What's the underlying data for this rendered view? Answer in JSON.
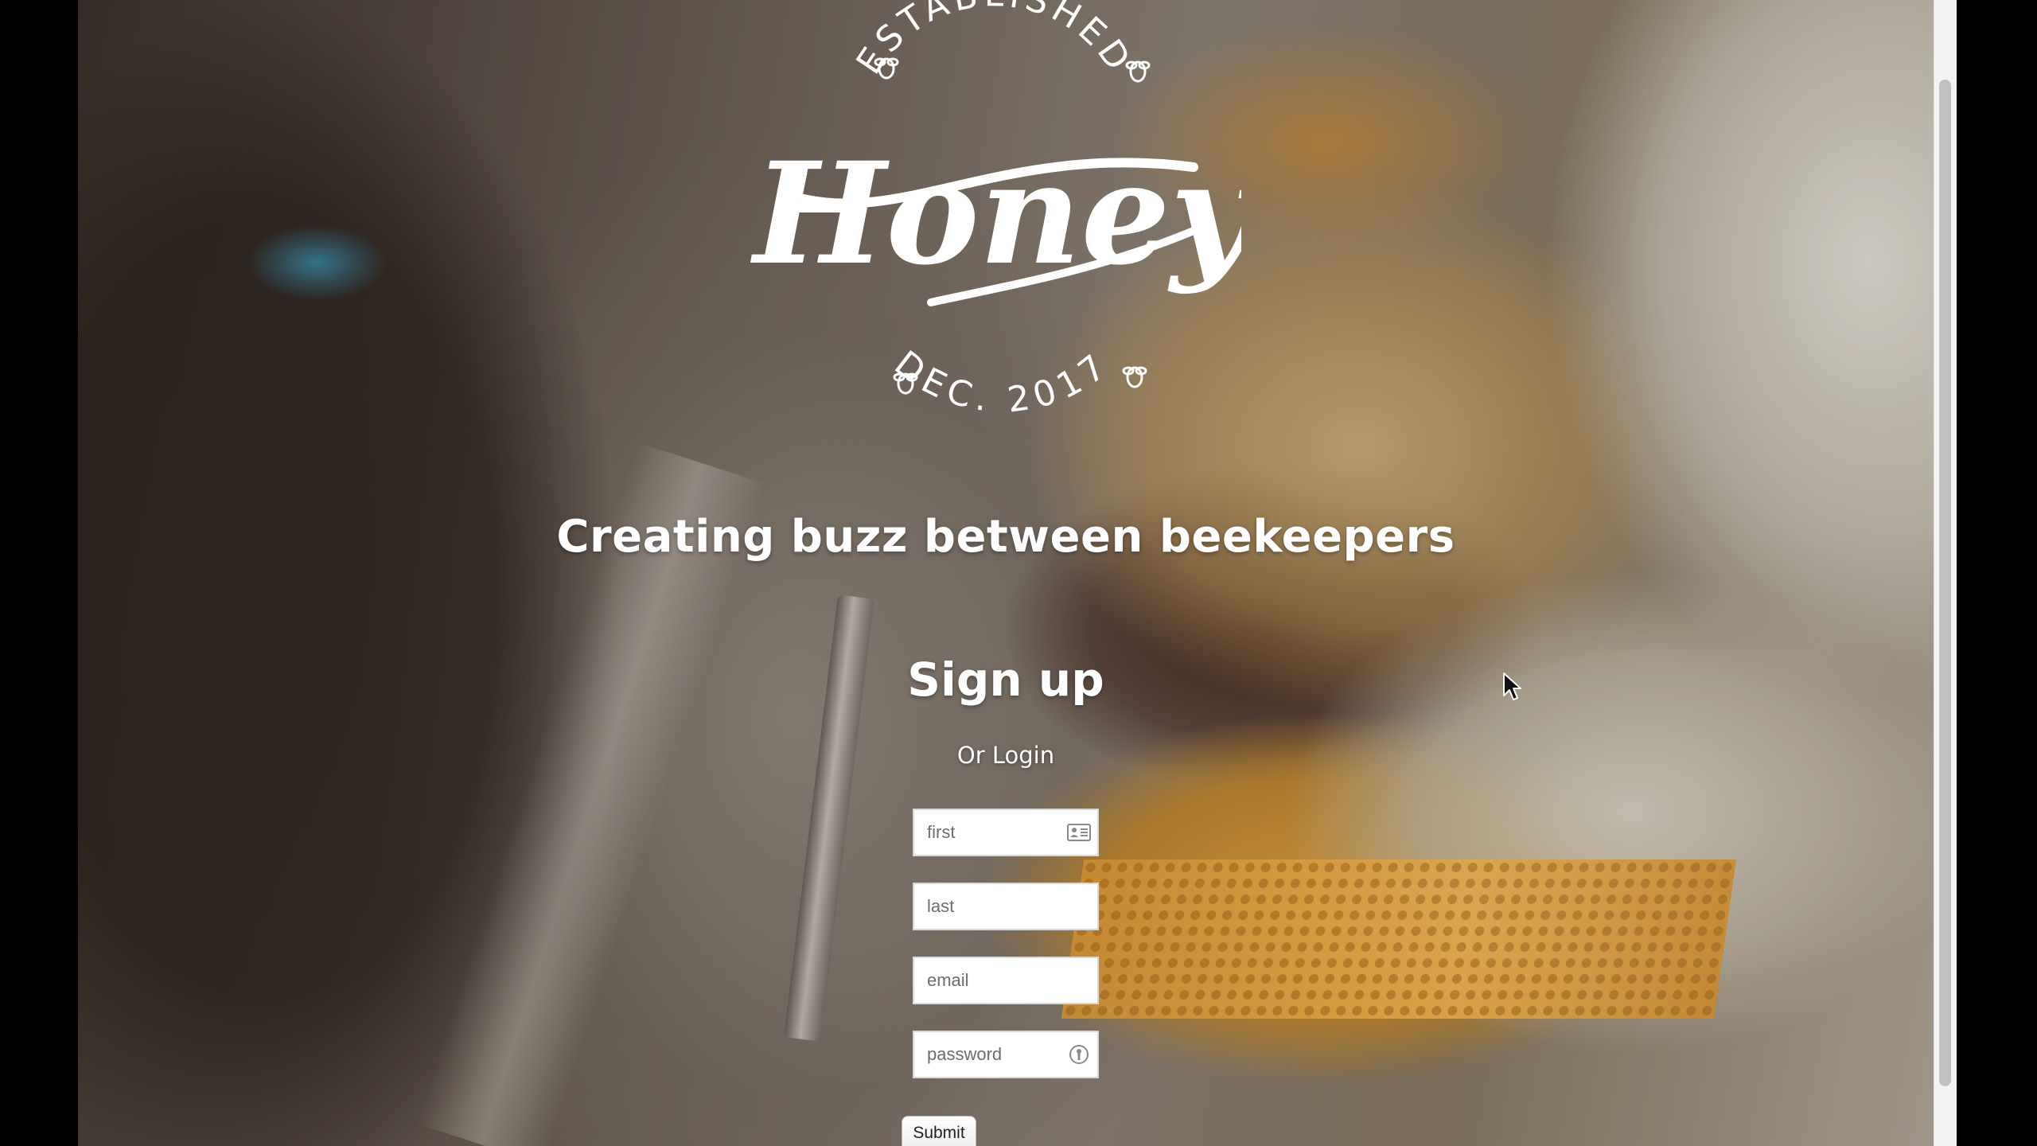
{
  "brand": {
    "arc_top": "ESTABLISHED",
    "script_name": "Honey",
    "arc_bottom": "DEC. 2017"
  },
  "hero": {
    "tagline": "Creating buzz between beekeepers"
  },
  "signup": {
    "title": "Sign up",
    "login_link": "Or Login",
    "fields": {
      "first": {
        "placeholder": "first",
        "value": ""
      },
      "last": {
        "placeholder": "last",
        "value": ""
      },
      "email": {
        "placeholder": "email",
        "value": ""
      },
      "password": {
        "placeholder": "password",
        "value": ""
      }
    },
    "submit_label": "Submit"
  },
  "icons": {
    "first_field_icon": "contact-card-icon",
    "password_field_icon": "password-key-icon",
    "bee_ornament": "bee-icon",
    "pointer": "mouse-pointer-icon"
  },
  "colors": {
    "text": "#ffffff",
    "field_background": "#ffffff",
    "field_border": "#d9d9d9",
    "scrollbar_thumb": "#c1c1c1"
  }
}
